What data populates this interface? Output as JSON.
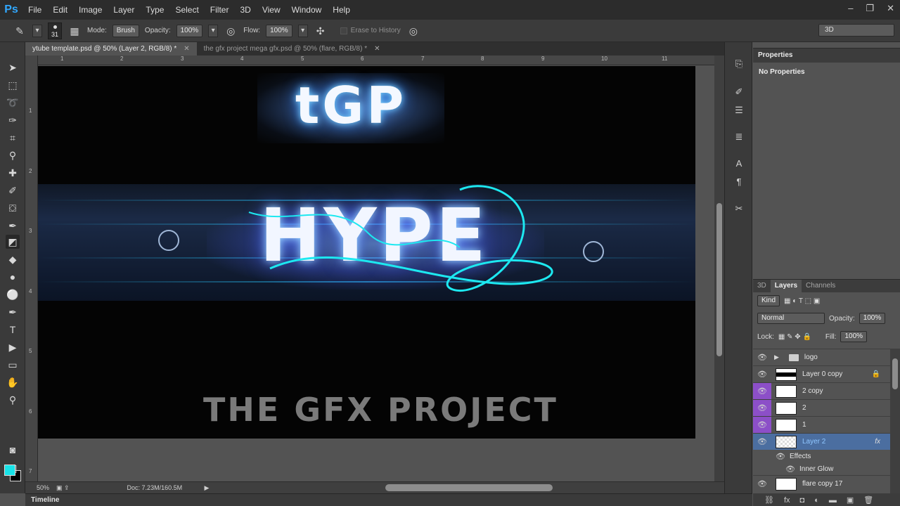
{
  "app": {
    "logo": "Ps"
  },
  "menu": [
    "File",
    "Edit",
    "Image",
    "Layer",
    "Type",
    "Select",
    "Filter",
    "3D",
    "View",
    "Window",
    "Help"
  ],
  "window_controls": {
    "minimize": "‒",
    "restore": "❐",
    "close": "✕"
  },
  "options": {
    "brush_size": "31",
    "mode_label": "Mode:",
    "mode_value": "Brush",
    "opacity_label": "Opacity:",
    "opacity_value": "100%",
    "flow_label": "Flow:",
    "flow_value": "100%",
    "erase_history": "Erase to History",
    "workspace": "3D"
  },
  "tabs": [
    {
      "label": "ytube template.psd @ 50% (Layer 2, RGB/8) *",
      "active": true
    },
    {
      "label": "the gfx project mega gfx.psd @ 50% (flare, RGB/8) *",
      "active": false
    }
  ],
  "ruler_top": [
    "1",
    "2",
    "3",
    "4",
    "5",
    "6",
    "7",
    "8",
    "9",
    "10",
    "11"
  ],
  "ruler_left": [
    "1",
    "2",
    "3",
    "4",
    "5",
    "6",
    "7"
  ],
  "canvas": {
    "top_logo": "tGP",
    "banner_text": "HYPE",
    "bottom_title": "THE GFX PROJECT"
  },
  "status": {
    "zoom": "50%",
    "doc": "Doc: 7.23M/160.5M"
  },
  "timeline": "Timeline",
  "properties": {
    "tab": "Properties",
    "text": "No Properties"
  },
  "layers_panel": {
    "tabs": [
      "3D",
      "Layers",
      "Channels"
    ],
    "kind": "Kind",
    "blend_mode": "Normal",
    "opacity_label": "Opacity:",
    "opacity_value": "100%",
    "lock_label": "Lock:",
    "fill_label": "Fill:",
    "fill_value": "100%",
    "layers": [
      {
        "name": "logo",
        "type": "group"
      },
      {
        "name": "Layer 0 copy",
        "locked": true
      },
      {
        "name": "2 copy",
        "purple": true
      },
      {
        "name": "2",
        "purple": true
      },
      {
        "name": "1",
        "purple": true
      },
      {
        "name": "Layer 2",
        "selected": true,
        "fx": "fx"
      },
      {
        "name": "Effects",
        "type": "effects"
      },
      {
        "name": "Inner Glow",
        "type": "effect"
      },
      {
        "name": "flare copy 17"
      }
    ]
  },
  "colors": {
    "foreground": "#17e3e8",
    "background": "#000000",
    "accent": "#31a8ff"
  }
}
